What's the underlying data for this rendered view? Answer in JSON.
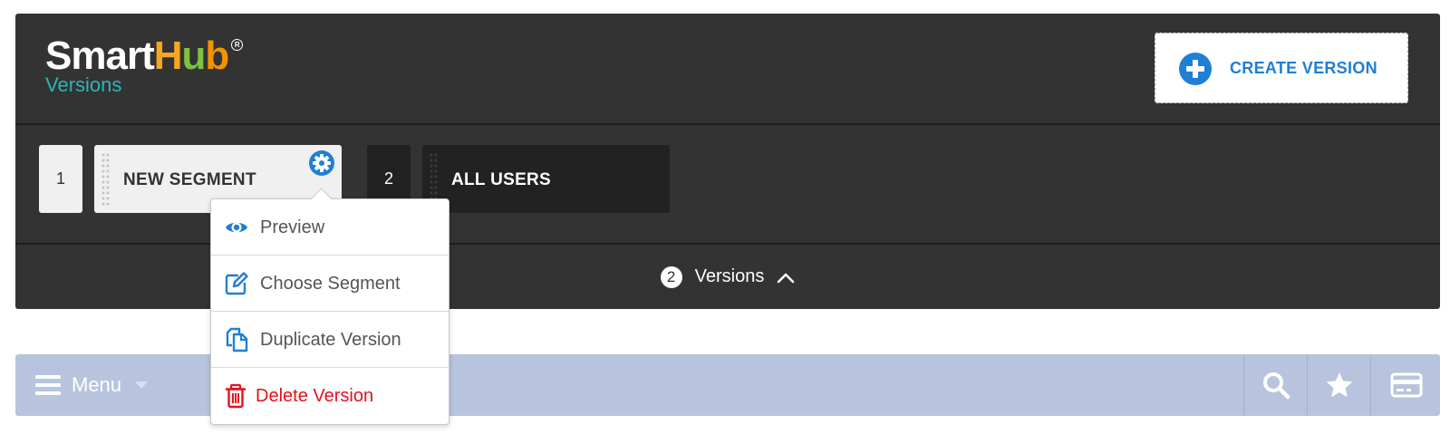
{
  "header": {
    "logo": {
      "word_smart": "Smart",
      "word_h": "H",
      "word_u": "u",
      "word_b": "b",
      "registered": "R",
      "subtitle": "Versions"
    },
    "create_button": {
      "label": "CREATE VERSION",
      "icon": "plus-circle-icon"
    }
  },
  "segments": [
    {
      "index": "1",
      "label": "NEW SEGMENT",
      "selected": true
    },
    {
      "index": "2",
      "label": "ALL USERS",
      "selected": false
    }
  ],
  "versions_bar": {
    "count": "2",
    "label": "Versions",
    "icon": "chevron-up-icon"
  },
  "context_menu": {
    "items": [
      {
        "label": "Preview",
        "icon": "eye-icon"
      },
      {
        "label": "Choose Segment",
        "icon": "edit-icon"
      },
      {
        "label": "Duplicate Version",
        "icon": "copy-icon"
      },
      {
        "label": "Delete Version",
        "icon": "trash-icon",
        "danger": true
      }
    ]
  },
  "navbar": {
    "menu_label": "Menu",
    "icons": [
      "search-icon",
      "star-icon",
      "credit-card-icon"
    ]
  },
  "colors": {
    "panel_bg": "#333333",
    "accent_blue": "#1f7fd4",
    "danger_red": "#e8101c",
    "navbar_bg": "#b8c4dd",
    "logo_teal": "#2cb5b8"
  }
}
